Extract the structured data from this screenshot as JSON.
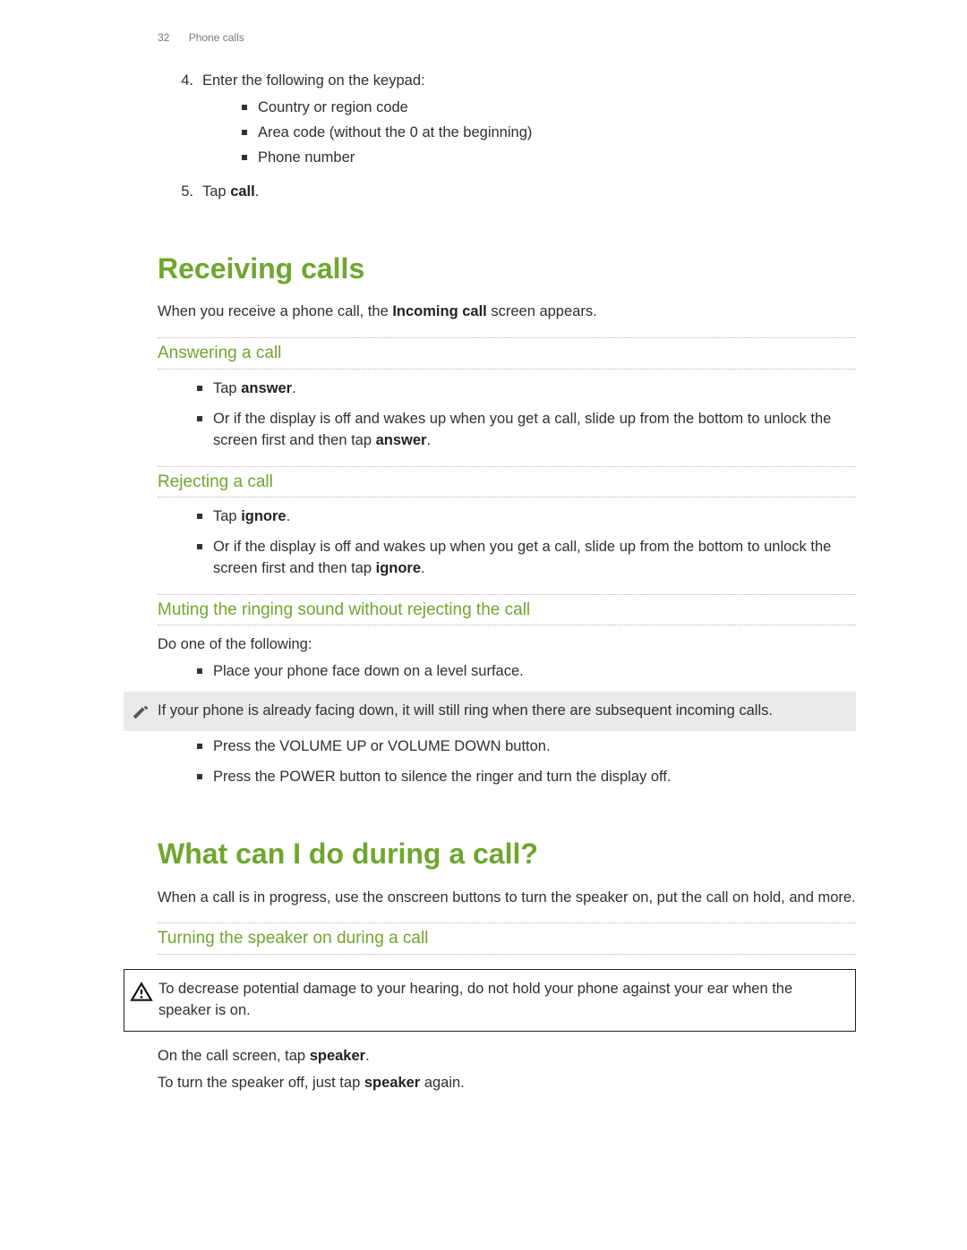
{
  "header": {
    "page": "32",
    "section": "Phone calls"
  },
  "steps": {
    "four": {
      "marker": "4.",
      "text": "Enter the following on the keypad:",
      "sub": [
        "Country or region code",
        "Area code (without the 0 at the beginning)",
        "Phone number"
      ]
    },
    "five": {
      "marker": "5.",
      "pre": "Tap ",
      "bold": "call",
      "post": "."
    }
  },
  "receiving": {
    "title": "Receiving calls",
    "intro_pre": "When you receive a phone call, the ",
    "intro_bold": "Incoming call",
    "intro_post": " screen appears.",
    "answering": {
      "title": "Answering a call",
      "b1_pre": "Tap ",
      "b1_bold": "answer",
      "b1_post": ".",
      "b2_pre": "Or if the display is off and wakes up when you get a call, slide up from the bottom to unlock the screen first and then tap ",
      "b2_bold": "answer",
      "b2_post": "."
    },
    "rejecting": {
      "title": "Rejecting a call",
      "b1_pre": "Tap ",
      "b1_bold": "ignore",
      "b1_post": ".",
      "b2_pre": "Or if the display is off and wakes up when you get a call, slide up from the bottom to unlock the screen first and then tap ",
      "b2_bold": "ignore",
      "b2_post": "."
    },
    "muting": {
      "title": "Muting the ringing sound without rejecting the call",
      "lead": "Do one of the following:",
      "b1": "Place your phone face down on a level surface.",
      "note": "If your phone is already facing down, it will still ring when there are subsequent incoming calls.",
      "b2": "Press the VOLUME UP or VOLUME DOWN button.",
      "b3": "Press the POWER button to silence the ringer and turn the display off."
    }
  },
  "during": {
    "title": "What can I do during a call?",
    "intro": "When a call is in progress, use the onscreen buttons to turn the speaker on, put the call on hold, and more.",
    "speaker": {
      "title": "Turning the speaker on during a call",
      "warn": "To decrease potential damage to your hearing, do not hold your phone against your ear when the speaker is on.",
      "p1_pre": "On the call screen, tap ",
      "p1_bold": "speaker",
      "p1_post": ".",
      "p2_pre": "To turn the speaker off, just tap ",
      "p2_bold": "speaker",
      "p2_post": " again."
    }
  }
}
